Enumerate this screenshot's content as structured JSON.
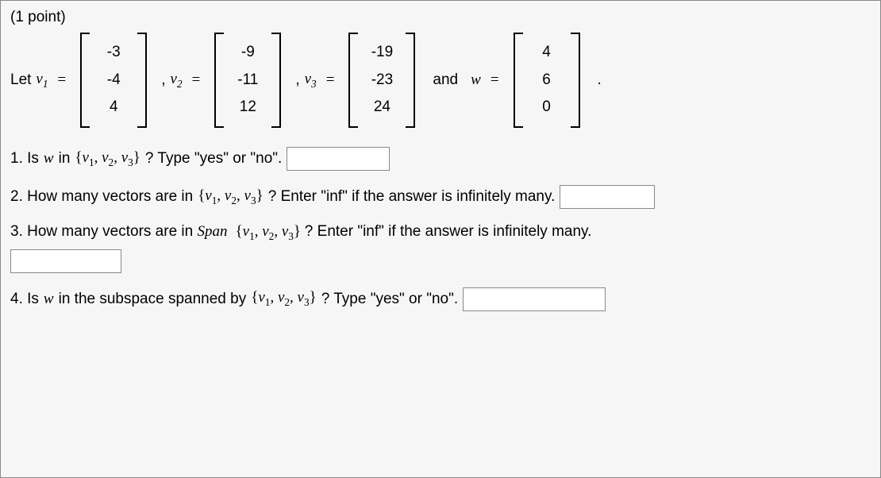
{
  "points": "(1 point)",
  "let": "Let ",
  "v": "v",
  "w": "w",
  "eq": "=",
  "comma": ",",
  "and": " and ",
  "dot": ".",
  "vectors": {
    "v1": [
      "-3",
      "-4",
      "4"
    ],
    "v2": [
      "-9",
      "-11",
      "12"
    ],
    "v3": [
      "-19",
      "-23",
      "24"
    ],
    "wv": [
      "4",
      "6",
      "0"
    ]
  },
  "q1": {
    "num": "1. Is ",
    "mid": " in ",
    "set_open": "{",
    "set_close": "}",
    "tail": "? Type \"yes\" or \"no\"."
  },
  "q2": {
    "num": "2. How many vectors are in ",
    "tail": "? Enter \"inf\" if the answer is infinitely many."
  },
  "q3": {
    "num": "3. How many vectors are in ",
    "span": "Span",
    "tail": "? Enter \"inf\" if the answer is infinitely many."
  },
  "q4": {
    "num": "4. Is ",
    "mid": " in the subspace spanned by ",
    "tail": "? Type \"yes\" or \"no\"."
  }
}
